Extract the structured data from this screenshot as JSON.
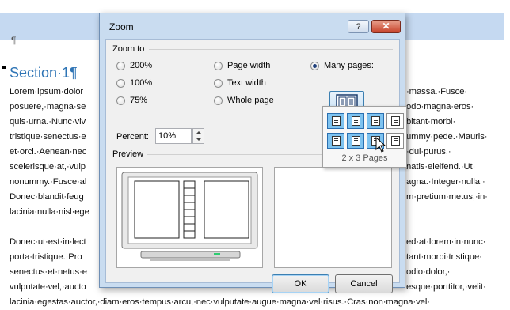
{
  "document": {
    "pilcrow": "¶",
    "section_title": "Section·1¶",
    "lines_left": [
      "Lorem·ipsum·dolor",
      "posuere,·magna·se",
      "quis·urna.·Nunc·viv",
      "tristique·senectus·e",
      "et·orci.·Aenean·nec",
      "scelerisque·at,·vulp",
      "nonummy.·Fusce·al",
      "Donec·blandit·feug",
      "lacinia·nulla·nisl·ege",
      "",
      "Donec·ut·est·in·lect",
      "porta·tristique.·Pro",
      "senectus·et·netus·e",
      "vulputate·vel,·aucto"
    ],
    "lines_right": [
      "·massa.·Fusce·",
      "odo·magna·eros·",
      "bitant·morbi·",
      "ummy·pede.·Mauris·",
      "·dui·purus,·",
      "natis·eleifend.·Ut·",
      "agna.·Integer·nulla.·",
      "m·pretium·metus,·in·",
      "",
      "",
      "ed·at·lorem·in·nunc·",
      "tant·morbi·tristique·",
      "odio·dolor,·",
      "esque·porttitor,·velit·"
    ],
    "last_line": "lacinia·egestas·auctor,·diam·eros·tempus·arcu,·nec·vulputate·augue·magna·vel·risus.·Cras·non·magna·vel·"
  },
  "dialog": {
    "title": "Zoom",
    "help_label": "?",
    "close_label": "✕",
    "zoom_to_label": "Zoom to",
    "options": {
      "z200": "200%",
      "z100": "100%",
      "z75": "75%",
      "page_width": "Page width",
      "text_width": "Text width",
      "whole_page": "Whole page",
      "many_pages": "Many pages:"
    },
    "percent_label": "Percent:",
    "percent_value": "10%",
    "preview_label": "Preview",
    "ok_label": "OK",
    "cancel_label": "Cancel"
  },
  "grid_picker": {
    "label": "2 x 3 Pages",
    "rows": 2,
    "cols": 4,
    "selected_rows": 2,
    "selected_cols": 3
  }
}
